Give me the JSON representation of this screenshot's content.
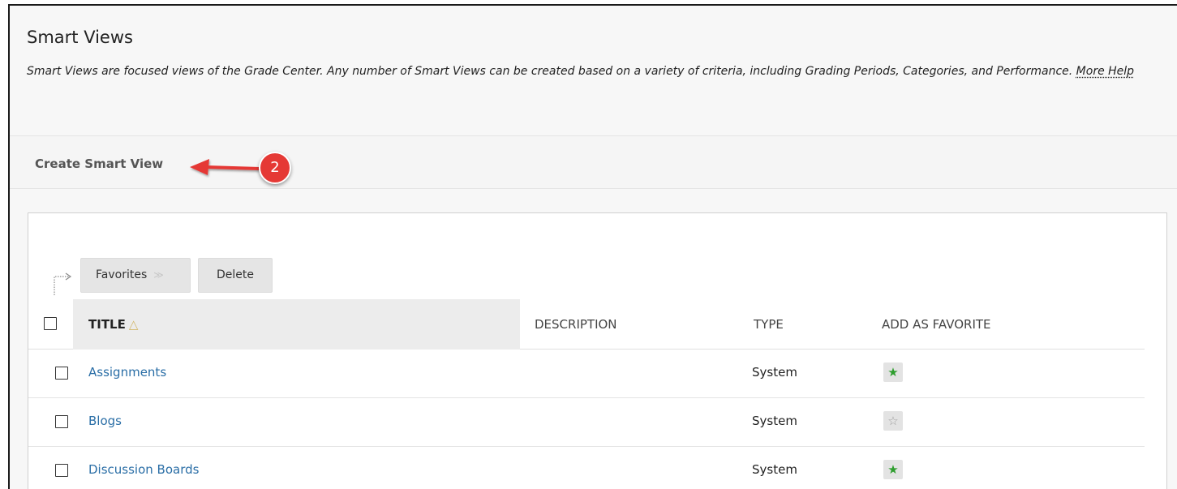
{
  "header": {
    "title": "Smart Views",
    "description": "Smart Views are focused views of the Grade Center. Any number of Smart Views can be created based on a variety of criteria, including Grading Periods, Categories, and Performance.",
    "help_link": "More Help"
  },
  "action_bar": {
    "create_label": "Create Smart View",
    "annotation_badge": "2"
  },
  "toolbar": {
    "favorites_label": "Favorites",
    "delete_label": "Delete"
  },
  "table": {
    "columns": [
      "TITLE",
      "DESCRIPTION",
      "TYPE",
      "ADD AS FAVORITE"
    ],
    "sort_indicator": "△",
    "rows": [
      {
        "title": "Assignments",
        "description": "",
        "type": "System",
        "favorite": true
      },
      {
        "title": "Blogs",
        "description": "",
        "type": "System",
        "favorite": false
      },
      {
        "title": "Discussion Boards",
        "description": "",
        "type": "System",
        "favorite": true
      }
    ]
  },
  "icons": {
    "favorite_on": "star-filled-green-icon",
    "favorite_off": "star-outline-icon",
    "chevron": "double-chevron-down-icon"
  },
  "colors": {
    "link": "#2a6ea6",
    "annotation": "#e53935",
    "favorite_on": "#2e9e2e"
  }
}
